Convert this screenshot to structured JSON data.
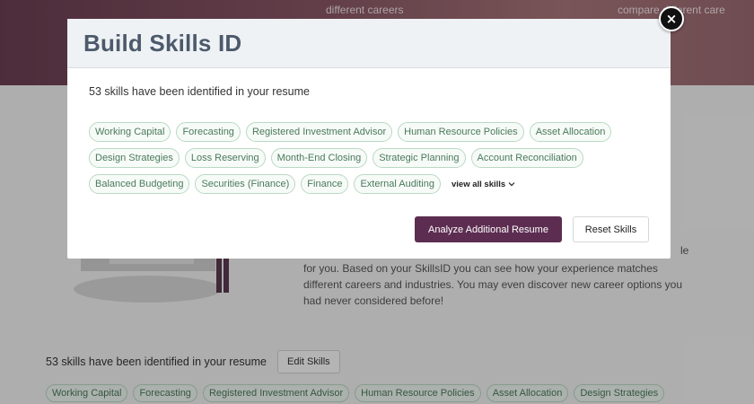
{
  "background": {
    "hero_text_left": "different careers",
    "hero_text_right": "compare different care",
    "intro_edge": "le",
    "intro_text": "for you. Based on your SkillsID you can see how your experience matches different careers and industries. You may even discover new career options you had never considered before!",
    "skills_count": "53 skills have been identified in your resume",
    "edit_skills_label": "Edit Skills",
    "tags": [
      "Working Capital",
      "Forecasting",
      "Registered Investment Advisor",
      "Human Resource Policies",
      "Asset Allocation",
      "Design Strategies"
    ]
  },
  "modal": {
    "title": "Build Skills ID",
    "close_label": "×",
    "skills_count": "53 skills have been identified in your resume",
    "tags": [
      "Working Capital",
      "Forecasting",
      "Registered Investment Advisor",
      "Human Resource Policies",
      "Asset Allocation",
      "Design Strategies",
      "Loss Reserving",
      "Month-End Closing",
      "Strategic Planning",
      "Account Reconciliation",
      "Balanced Budgeting",
      "Securities (Finance)",
      "Finance",
      "External Auditing"
    ],
    "view_all_label": "view all skills",
    "view_all_icon": "chevron-down-icon",
    "analyze_label": "Analyze Additional Resume",
    "reset_label": "Reset Skills"
  },
  "colors": {
    "accent": "#5c2d51",
    "tag_border": "#b9d9c3",
    "tag_text": "#4a7a5a"
  }
}
